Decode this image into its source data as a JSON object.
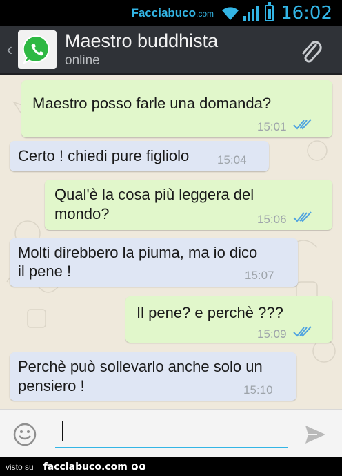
{
  "status_bar": {
    "site": "Facciabuco",
    "site_suffix": ".com",
    "time": "16:02"
  },
  "header": {
    "contact_name": "Maestro buddhista",
    "contact_status": "online"
  },
  "colors": {
    "accent": "#33b5e5",
    "outgoing_bubble": "#e1f7cb",
    "incoming_bubble": "#dfe6f4",
    "read_ticks": "#4fa3e0"
  },
  "messages": [
    {
      "direction": "out",
      "lines": [
        "Maestro posso farle una domanda?"
      ],
      "time": "15:01",
      "status": "read"
    },
    {
      "direction": "in",
      "lines": [
        "Certo ! chiedi pure figliolo"
      ],
      "time": "15:04"
    },
    {
      "direction": "out",
      "lines": [
        "Qual'è la cosa più leggera del",
        "mondo?"
      ],
      "time": "15:06",
      "status": "read"
    },
    {
      "direction": "in",
      "lines": [
        "Molti direbbero la piuma, ma io dico",
        "il pene !"
      ],
      "time": "15:07"
    },
    {
      "direction": "out",
      "lines": [
        "Il pene? e perchè ???"
      ],
      "time": "15:09",
      "status": "read"
    },
    {
      "direction": "in",
      "lines": [
        "Perchè può sollevarlo anche solo un",
        "pensiero !"
      ],
      "time": "15:10"
    }
  ],
  "input": {
    "value": "",
    "icons": [
      "emoji-icon",
      "send-icon"
    ]
  },
  "footer": {
    "visto": "visto su",
    "brand": "facciabuco.com"
  }
}
